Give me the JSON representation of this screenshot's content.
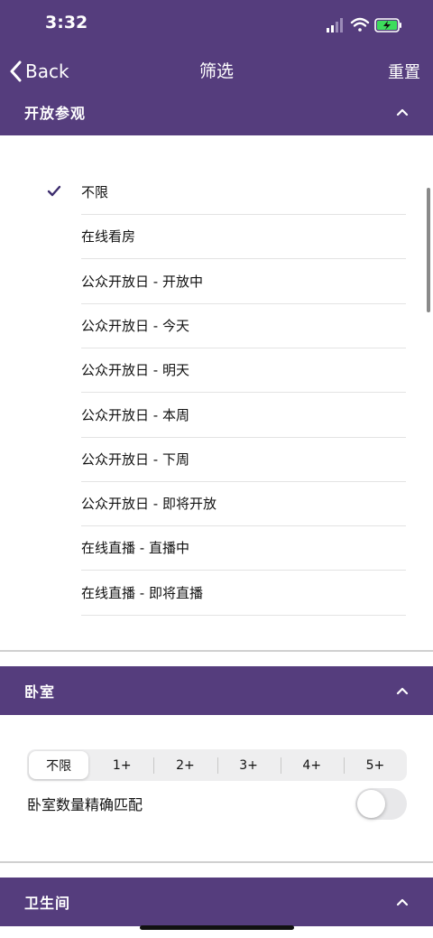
{
  "status_bar": {
    "time": "3:32"
  },
  "nav": {
    "back_label": "Back",
    "title": "筛选",
    "reset_label": "重置"
  },
  "open_house": {
    "header": "开放参观",
    "options": [
      {
        "label": "不限",
        "selected": true
      },
      {
        "label": "在线看房",
        "selected": false
      },
      {
        "label": "公众开放日 - 开放中",
        "selected": false
      },
      {
        "label": "公众开放日 - 今天",
        "selected": false
      },
      {
        "label": "公众开放日 - 明天",
        "selected": false
      },
      {
        "label": "公众开放日 - 本周",
        "selected": false
      },
      {
        "label": "公众开放日 - 下周",
        "selected": false
      },
      {
        "label": "公众开放日 - 即将开放",
        "selected": false
      },
      {
        "label": "在线直播 - 直播中",
        "selected": false
      },
      {
        "label": "在线直播 - 即将直播",
        "selected": false
      }
    ]
  },
  "bedrooms": {
    "header": "卧室",
    "segments": [
      "不限",
      "1+",
      "2+",
      "3+",
      "4+",
      "5+"
    ],
    "selected_index": 0,
    "exact_match_label": "卧室数量精确匹配",
    "exact_match_on": false
  },
  "bathrooms": {
    "header": "卫生间"
  },
  "colors": {
    "accent": "#553d7d"
  }
}
